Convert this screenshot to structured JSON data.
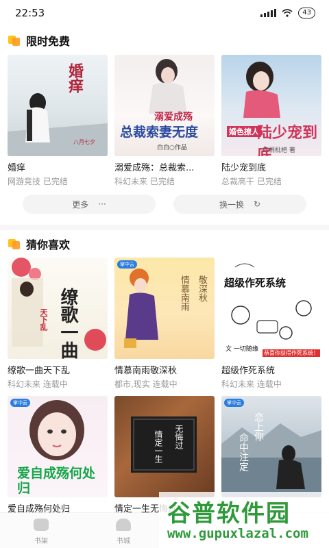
{
  "status_bar": {
    "time": "22:53",
    "battery": "43"
  },
  "limited_free": {
    "title": "限时免费",
    "books": [
      {
        "title": "婚痒",
        "genre": "网游竞技",
        "status": "已完结",
        "cover_text": "婚痒",
        "cover_sub": "八月七夕"
      },
      {
        "title": "溺爱成殇：总裁索...",
        "genre": "科幻未来",
        "status": "已完结",
        "cover_text": "总裁索妻无度",
        "cover_sub": "溺爱成殇",
        "cover_author": "白白○作品"
      },
      {
        "title": "陆少宠到底",
        "genre": "总裁高干",
        "status": "已完结",
        "cover_text": "陆少宠到底",
        "cover_sub": "婚色撩人",
        "cover_author": "红梢枇杷 著"
      }
    ],
    "more_label": "更多",
    "more_glyph": "···",
    "refresh_label": "换一换",
    "refresh_glyph": "↻"
  },
  "guess_you_like": {
    "title": "猜你喜欢",
    "books": [
      {
        "title": "缭歌一曲天下乱",
        "genre": "科幻未来",
        "status": "连载中",
        "cover_text": "缭歌一曲",
        "cover_sub": "天下乱"
      },
      {
        "title": "情慕南雨敬深秋",
        "genre": "都市,现实",
        "status": "连载中",
        "cover_text": "情慕南雨",
        "cover_sub": "敬深秋",
        "cover_badge": "掌中云"
      },
      {
        "title": "超级作死系统",
        "genre": "科幻未来",
        "status": "连载中",
        "cover_text": "超级作死系统",
        "cover_sub": "文 一切随缘",
        "cover_caption": "恭喜你获得作死系统！"
      },
      {
        "title": "爱自成殇何处归",
        "genre": "",
        "status": "",
        "cover_text": "爱自成殇何处归",
        "cover_badge": "掌中云"
      },
      {
        "title": "情定一生无悔过",
        "genre": "",
        "status": "",
        "cover_text": "无悔过",
        "cover_sub": "情定一生"
      },
      {
        "title": "",
        "genre": "",
        "status": "",
        "cover_text": "命中注定",
        "cover_sub": "恋上你",
        "cover_badge": "掌中云"
      }
    ]
  },
  "bottom_nav": {
    "items": [
      {
        "label": "书架"
      },
      {
        "label": "书城"
      }
    ]
  },
  "watermark": {
    "main": "谷普软件园",
    "url": "www.gupuxlazal.com"
  },
  "colors": {
    "accent_yellow": "#ffc21a",
    "accent_orange": "#ff9a24",
    "watermark_green": "#2e9a3a"
  }
}
